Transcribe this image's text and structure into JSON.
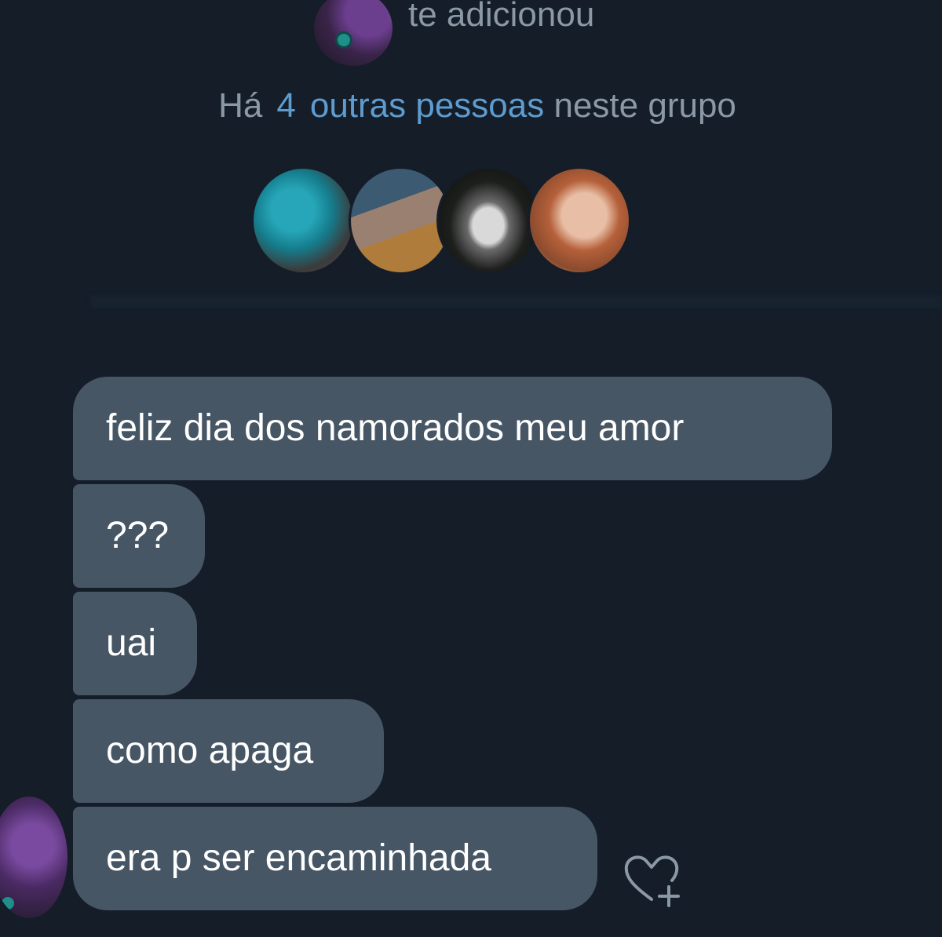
{
  "header": {
    "added_text": "te adicionou",
    "group_info": {
      "prefix": "Há",
      "count": "4",
      "link": "outras pessoas",
      "suffix": "neste grupo"
    }
  },
  "members": [
    {
      "icon": "member-avatar-1"
    },
    {
      "icon": "member-avatar-2"
    },
    {
      "icon": "member-avatar-3"
    },
    {
      "icon": "member-avatar-4"
    }
  ],
  "messages": [
    {
      "text": "feliz dia dos namorados meu amor"
    },
    {
      "text": "???"
    },
    {
      "text": "uai"
    },
    {
      "text": "como apaga"
    },
    {
      "text": "era p ser encaminhada"
    }
  ],
  "icons": {
    "react": "heart-plus-icon"
  },
  "colors": {
    "background": "#141d28",
    "bubble": "#475665",
    "link": "#5e9cd0",
    "muted_text": "#8b98a5"
  }
}
